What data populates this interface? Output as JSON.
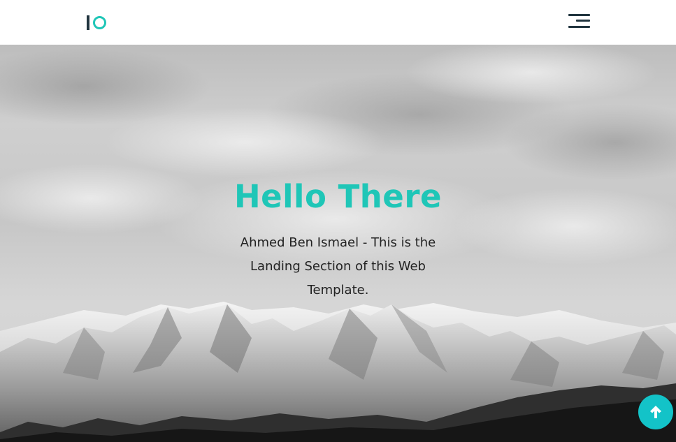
{
  "header": {
    "logo_text": "IO",
    "menu_icon": "hamburger-menu-icon"
  },
  "hero": {
    "title": "Hello There",
    "subtitle": "Ahmed Ben Ismael - This is the Landing Section of this Web Template.",
    "background": "snowy-mountains-photo"
  },
  "scroll_top": {
    "icon": "arrow-up-icon"
  },
  "colors": {
    "accent": "#1fc6b7",
    "dark": "#21353f",
    "button": "#13c3c8"
  }
}
